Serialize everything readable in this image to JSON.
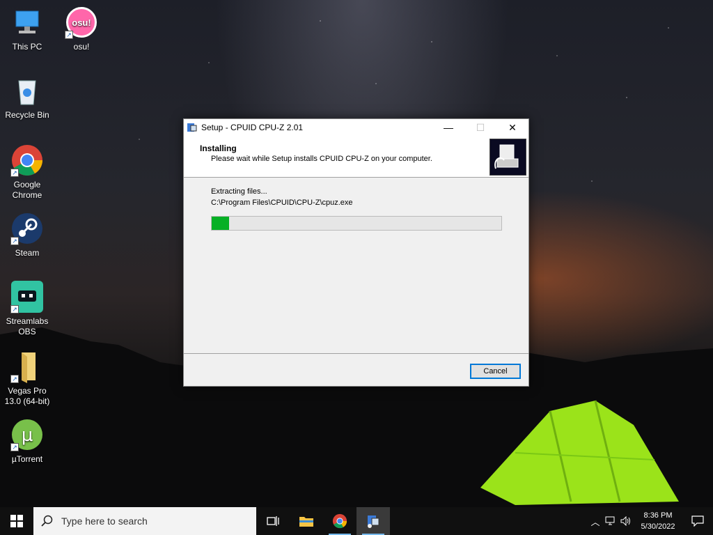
{
  "desktop": {
    "icons": [
      {
        "label": "This PC"
      },
      {
        "label": "osu!",
        "badge": "osu!"
      },
      {
        "label": "Recycle Bin"
      },
      {
        "label": "Google\nChrome"
      },
      {
        "label": "Steam"
      },
      {
        "label": "Streamlabs\nOBS"
      },
      {
        "label": "Vegas Pro\n13.0 (64-bit)"
      },
      {
        "label": "µTorrent"
      }
    ]
  },
  "dialog": {
    "title": "Setup - CPUID CPU-Z 2.01",
    "header_title": "Installing",
    "header_subtitle": "Please wait while Setup installs CPUID CPU-Z on your computer.",
    "status": "Extracting files...",
    "file_path": "C:\\Program Files\\CPUID\\CPU-Z\\cpuz.exe",
    "progress_fraction": 0.06,
    "cancel_label": "Cancel",
    "controls": {
      "minimize": "—",
      "maximize": "☐",
      "close": "✕"
    }
  },
  "taskbar": {
    "search_placeholder": "Type here to search",
    "time": "8:36 PM",
    "date": "5/30/2022"
  },
  "colors": {
    "progress": "#06b025",
    "accent": "#0078d7",
    "taskbar": "#101010"
  }
}
